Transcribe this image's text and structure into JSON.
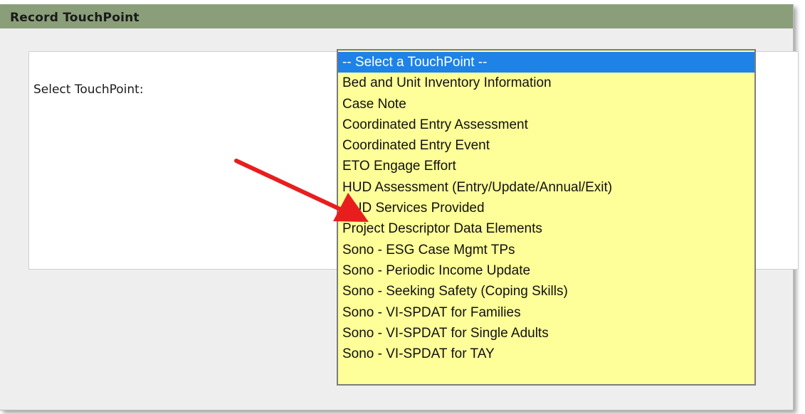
{
  "panel": {
    "title": "Record TouchPoint"
  },
  "form": {
    "label": "Select TouchPoint:",
    "listbox": {
      "options": [
        {
          "label": "-- Select a TouchPoint --",
          "selected": true
        },
        {
          "label": "Bed and Unit Inventory Information"
        },
        {
          "label": "Case Note"
        },
        {
          "label": "Coordinated Entry Assessment"
        },
        {
          "label": "Coordinated Entry Event"
        },
        {
          "label": "ETO Engage Effort"
        },
        {
          "label": "HUD Assessment (Entry/Update/Annual/Exit)"
        },
        {
          "label": "HUD Services Provided"
        },
        {
          "label": "Project Descriptor Data Elements"
        },
        {
          "label": "Sono - ESG Case Mgmt TPs"
        },
        {
          "label": "Sono - Periodic Income Update"
        },
        {
          "label": "Sono - Seeking Safety (Coping Skills)"
        },
        {
          "label": "Sono - VI-SPDAT for Families"
        },
        {
          "label": "Sono - VI-SPDAT for Single Adults"
        },
        {
          "label": "Sono - VI-SPDAT for TAY"
        }
      ]
    }
  },
  "colors": {
    "titlebar": "#8a9f79",
    "listbox_bg": "#ffff99",
    "selected_bg": "#1e82e6",
    "arrow": "#e81e1e"
  },
  "annotation": {
    "icon": "red-pointer-arrow-icon",
    "points_to_option_index": 6
  }
}
